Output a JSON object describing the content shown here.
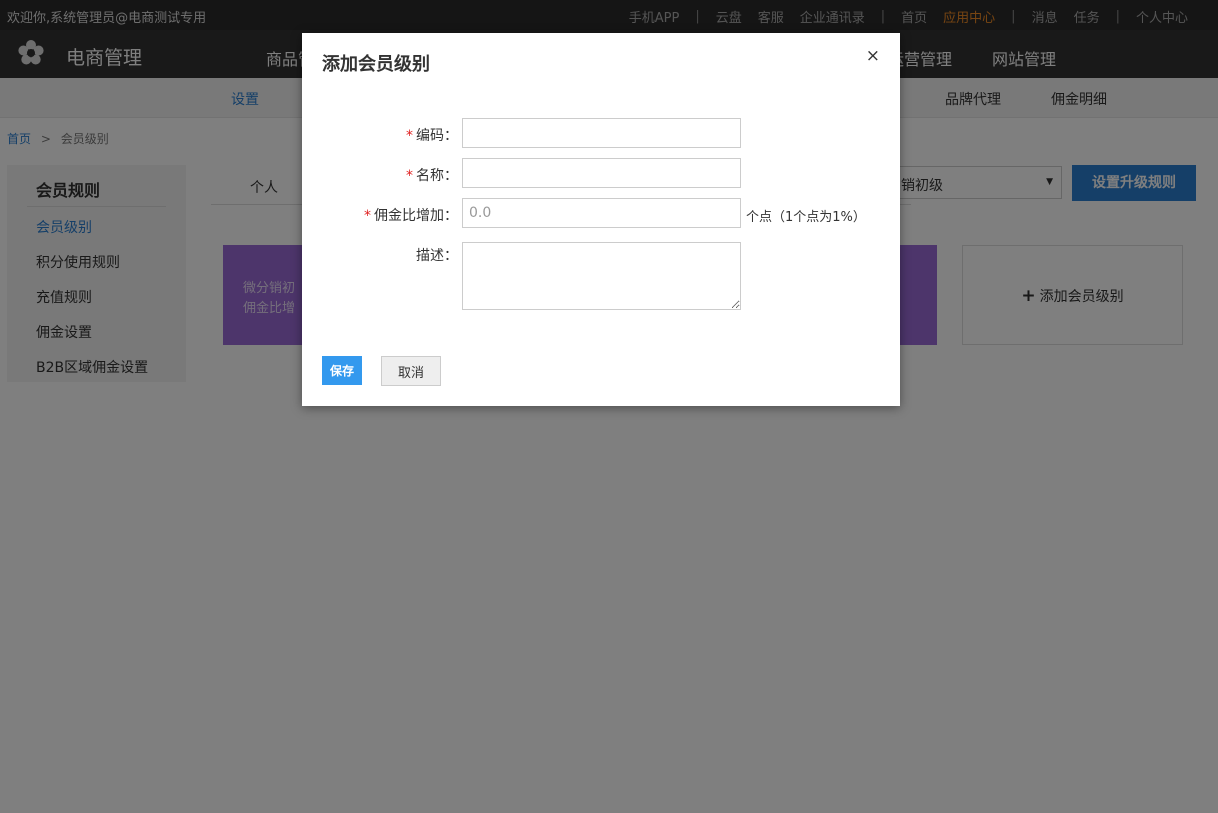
{
  "topbar": {
    "welcome": "欢迎你,系统管理员@电商测试专用",
    "links_group1": [
      "手机APP"
    ],
    "links_group2": [
      "云盘",
      "客服",
      "企业通讯录"
    ],
    "links_group3": [
      "首页",
      "应用中心"
    ],
    "links_group4": [
      "消息",
      "任务"
    ],
    "links_group5": [
      "个人中心"
    ],
    "separator": "|",
    "active_color": "#f08a24"
  },
  "header": {
    "logo_icon": "flower-icon",
    "logo_text": "电商管理",
    "nav_left": "商品管",
    "nav_right": [
      "运营管理",
      "网站管理"
    ]
  },
  "subnav": {
    "item_settings": "设置",
    "item_brand": "品牌代理",
    "item_commission": "佣金明细"
  },
  "breadcrumb": {
    "home": "首页",
    "separator": ">",
    "current": "会员级别"
  },
  "sidebar": {
    "title": "会员规则",
    "items": [
      "会员级别",
      "积分使用规则",
      "充值规则",
      "佣金设置",
      "B2B区域佣金设置"
    ]
  },
  "content": {
    "tab_personal": "个人",
    "select_value": "销初级",
    "upgrade_button": "设置升级规则",
    "card_line1": "微分销初",
    "card_line2": "佣金比增",
    "add_level": "添加会员级别"
  },
  "modal": {
    "title": "添加会员级别",
    "close": "×",
    "required_mark": "*",
    "code_label": "编码：",
    "name_label": "名称：",
    "commission_label": "佣金比增加：",
    "commission_placeholder": "0.0",
    "commission_suffix": "个点（1个点为1%）",
    "desc_label": "描述：",
    "save_button": "保存",
    "cancel_button": "取消"
  },
  "colors": {
    "accent": "#2b7fd1",
    "card": "#9b6ad6",
    "required": "#e02020"
  }
}
